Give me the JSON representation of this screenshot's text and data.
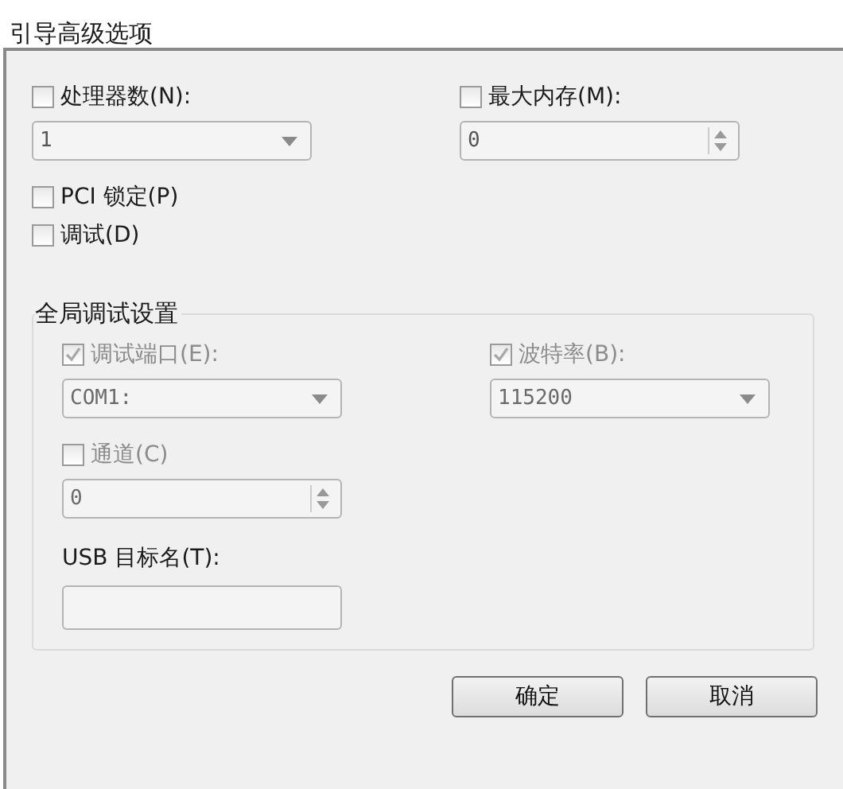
{
  "window": {
    "title": "引导高级选项"
  },
  "options": [
    {
      "kind": "combo",
      "label": "处理器数(N):",
      "checked": false,
      "disabled": false,
      "value": "1"
    },
    {
      "kind": "spin",
      "label": "最大内存(M):",
      "checked": false,
      "disabled": false,
      "value": "0"
    }
  ],
  "flags": [
    {
      "label": "PCI 锁定(P)",
      "checked": false
    },
    {
      "label": "调试(D)",
      "checked": false
    }
  ],
  "debug_group": {
    "title": "全局调试设置",
    "options": [
      {
        "kind": "combo",
        "label": "调试端口(E):",
        "checked": true,
        "disabled": true,
        "value": "COM1:"
      },
      {
        "kind": "combo",
        "label": "波特率(B):",
        "checked": true,
        "disabled": true,
        "value": "115200"
      },
      {
        "kind": "spin",
        "label": "通道(C)",
        "checked": false,
        "disabled": true,
        "value": "0"
      }
    ],
    "usb_label": "USB 目标名(T):"
  },
  "buttons": [
    "确定",
    "取消"
  ]
}
